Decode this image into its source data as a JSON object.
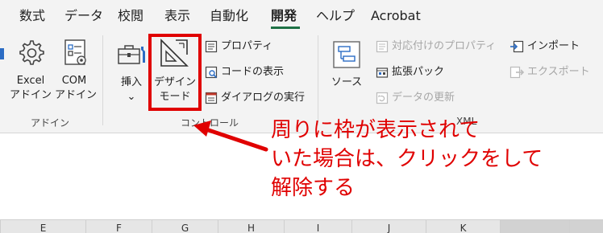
{
  "tabs": [
    {
      "label": "数式",
      "active": false
    },
    {
      "label": "データ",
      "active": false
    },
    {
      "label": "校閲",
      "active": false
    },
    {
      "label": "表示",
      "active": false
    },
    {
      "label": "自動化",
      "active": false
    },
    {
      "label": "開発",
      "active": true
    },
    {
      "label": "ヘルプ",
      "active": false
    },
    {
      "label": "Acrobat",
      "active": false
    }
  ],
  "ribbon": {
    "addins_group": {
      "excel_addin": {
        "line1": "Excel",
        "line2": "アドイン",
        "icon": "gear-icon"
      },
      "com_addin": {
        "line1": "COM",
        "line2": "アドイン",
        "icon": "com-addin-icon"
      },
      "label": "アドイン"
    },
    "controls_group": {
      "insert": {
        "line1": "挿入",
        "line2": "⌄",
        "icon": "toolbox-icon"
      },
      "design_mode": {
        "line1": "デザイン",
        "line2": "モード",
        "icon": "design-mode-icon"
      },
      "properties": {
        "label": "プロパティ",
        "icon": "properties-icon"
      },
      "view_code": {
        "label": "コードの表示",
        "icon": "view-code-icon"
      },
      "run_dialog": {
        "label": "ダイアログの実行",
        "icon": "run-dialog-icon"
      },
      "label": "コントロール"
    },
    "xml_group": {
      "source": {
        "label": "ソース",
        "icon": "source-icon"
      },
      "map_properties": {
        "label": "対応付けのプロパティ",
        "disabled": true,
        "icon": "map-properties-icon"
      },
      "expansion_pack": {
        "label": "拡張パック",
        "disabled": false,
        "icon": "expansion-pack-icon"
      },
      "refresh_data": {
        "label": "データの更新",
        "disabled": true,
        "icon": "refresh-data-icon"
      },
      "import": {
        "label": "インポート",
        "disabled": false,
        "icon": "import-icon"
      },
      "export": {
        "label": "エクスポート",
        "disabled": true,
        "icon": "export-icon"
      },
      "label": "XML"
    }
  },
  "sheet": {
    "columns": [
      {
        "label": "E",
        "selected": false
      },
      {
        "label": "F",
        "selected": false
      },
      {
        "label": "G",
        "selected": false
      },
      {
        "label": "H",
        "selected": false
      },
      {
        "label": "I",
        "selected": false
      },
      {
        "label": "J",
        "selected": false
      },
      {
        "label": "K",
        "selected": false
      },
      {
        "label": "",
        "selected": true
      },
      {
        "label": "",
        "selected": true
      }
    ]
  },
  "annotation": {
    "line1": "周りに枠が表示されて",
    "line2": "いた場合は、クリックをして",
    "line3": "解除する"
  },
  "colors": {
    "accent_green": "#1e7145",
    "annotation_red": "#e00000",
    "ribbon_bg": "#f3f3f3"
  }
}
